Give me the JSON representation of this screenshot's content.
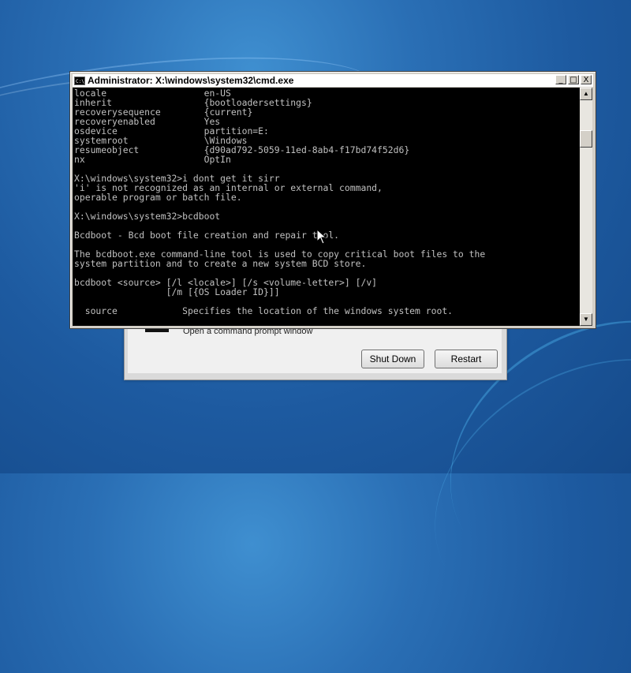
{
  "background_dialog": {
    "partial_text": "Open a command prompt window",
    "shut_down_label": "Shut Down",
    "restart_label": "Restart"
  },
  "window": {
    "title": "Administrator: X:\\windows\\system32\\cmd.exe",
    "icon": "cmd-app-icon",
    "controls": {
      "minimize": "_",
      "maximize": "□",
      "close": "X"
    }
  },
  "console": {
    "lines": [
      "locale                  en-US",
      "inherit                 {bootloadersettings}",
      "recoverysequence        {current}",
      "recoveryenabled         Yes",
      "osdevice                partition=E:",
      "systemroot              \\Windows",
      "resumeobject            {d90ad792-5059-11ed-8ab4-f17bd74f52d6}",
      "nx                      OptIn",
      "",
      "X:\\windows\\system32>i dont get it sirr",
      "'i' is not recognized as an internal or external command,",
      "operable program or batch file.",
      "",
      "X:\\windows\\system32>bcdboot",
      "",
      "Bcdboot - Bcd boot file creation and repair tool.",
      "",
      "The bcdboot.exe command-line tool is used to copy critical boot files to the",
      "system partition and to create a new system BCD store.",
      "",
      "bcdboot <source> [/l <locale>] [/s <volume-letter>] [/v]",
      "                 [/m [{OS Loader ID}]]",
      "",
      "  source            Specifies the location of the windows system root."
    ]
  },
  "colors": {
    "console_bg": "#000000",
    "console_text": "#c0c0c0",
    "desktop": "#2a6fb5"
  }
}
